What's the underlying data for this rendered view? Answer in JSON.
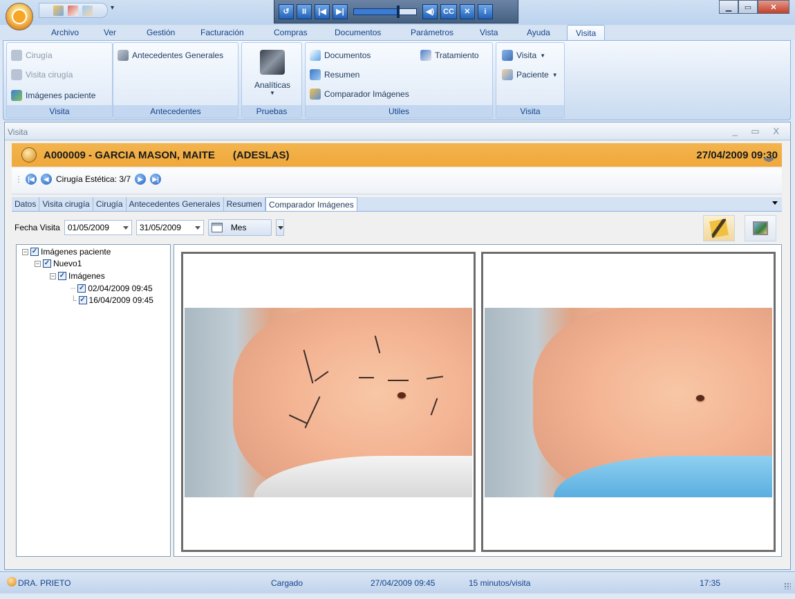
{
  "menu": [
    "Archivo",
    "Ver",
    "Gestión",
    "Facturación",
    "Compras",
    "Documentos",
    "Parámetros",
    "Vista",
    "Ayuda",
    "Visita"
  ],
  "media_buttons": [
    "↺",
    "II",
    "|◀",
    "▶|",
    "◀)",
    "CC",
    "✕",
    "i"
  ],
  "window_buttons": [
    "▁",
    "▭",
    "✕"
  ],
  "ribbon": {
    "g1": {
      "items": [
        "Cirugía",
        "Visita cirugía",
        "Imágenes paciente"
      ],
      "label": "Visita"
    },
    "g2": {
      "items": [
        "Antecedentes Generales"
      ],
      "label": "Antecedentes"
    },
    "g3": {
      "big": "Analíticas",
      "label": "Pruebas"
    },
    "g4": {
      "items": [
        "Documentos",
        "Resumen",
        "Comparador Imágenes",
        "Tratamiento"
      ],
      "label": "Utiles"
    },
    "g5": {
      "items": [
        "Visita",
        "Paciente"
      ],
      "label": "Visita"
    }
  },
  "doc": {
    "title": "Visita",
    "controls": "_ ▭ X",
    "patient": "A000009 - GARCIA MASON, MAITE",
    "insurer": "(ADESLAS)",
    "datetime": "27/04/2009 09:30",
    "nav_label": "Cirugía Estética: 3/7",
    "tabs": [
      "Datos",
      "Visita cirugía",
      "Cirugía",
      "Antecedentes Generales",
      "Resumen",
      "Comparador Imágenes"
    ],
    "filter_label": "Fecha Visita",
    "date_from": "01/05/2009",
    "date_to": "31/05/2009",
    "period": "Mes"
  },
  "tree": {
    "root": "Imágenes paciente",
    "child": "Nuevo1",
    "folder": "Imágenes",
    "items": [
      "02/04/2009 09:45",
      "16/04/2009 09:45"
    ]
  },
  "status": {
    "user": "DRA. PRIETO",
    "state": "Cargado",
    "datetime": "27/04/2009 09:45",
    "interval": "15 minutos/visita",
    "time": "17:35"
  }
}
